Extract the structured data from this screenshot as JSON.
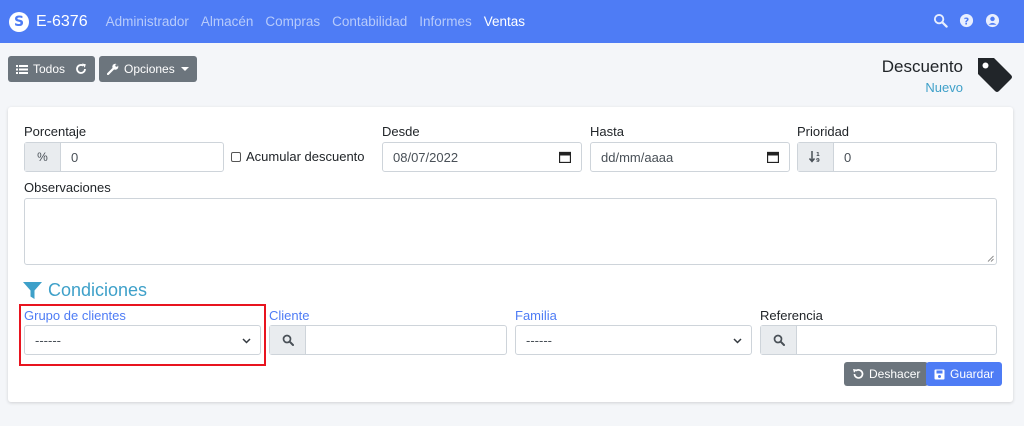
{
  "navbar": {
    "brand": "E-6376",
    "items": [
      "Administrador",
      "Almacén",
      "Compras",
      "Contabilidad",
      "Informes",
      "Ventas"
    ],
    "active": "Ventas",
    "icons": [
      "search-icon",
      "help-icon",
      "user-icon"
    ]
  },
  "toolbar": {
    "all_label": "Todos",
    "options_label": "Opciones"
  },
  "page": {
    "title": "Descuento",
    "subtitle": "Nuevo"
  },
  "form": {
    "percentage": {
      "label": "Porcentaje",
      "value": "0",
      "addon": "%"
    },
    "accumulate": {
      "label": "Acumular descuento",
      "checked": false
    },
    "from": {
      "label": "Desde",
      "value": "08/07/2022"
    },
    "to": {
      "label": "Hasta",
      "value": "dd/mm/aaaa"
    },
    "priority": {
      "label": "Prioridad",
      "value": "0"
    },
    "observations": {
      "label": "Observaciones",
      "value": ""
    }
  },
  "conditions": {
    "title": "Condiciones",
    "customer_group": {
      "label": "Grupo de clientes",
      "value": "------"
    },
    "customer": {
      "label": "Cliente",
      "value": ""
    },
    "family": {
      "label": "Familia",
      "value": "------"
    },
    "reference": {
      "label": "Referencia",
      "value": ""
    }
  },
  "actions": {
    "undo_label": "Deshacer",
    "save_label": "Guardar"
  },
  "colors": {
    "navbar": "#4e7cf5",
    "accent": "#3ea0c9",
    "highlight": "#e8141f",
    "grey_button": "#6c757d",
    "save_button": "#4e7cf5"
  }
}
